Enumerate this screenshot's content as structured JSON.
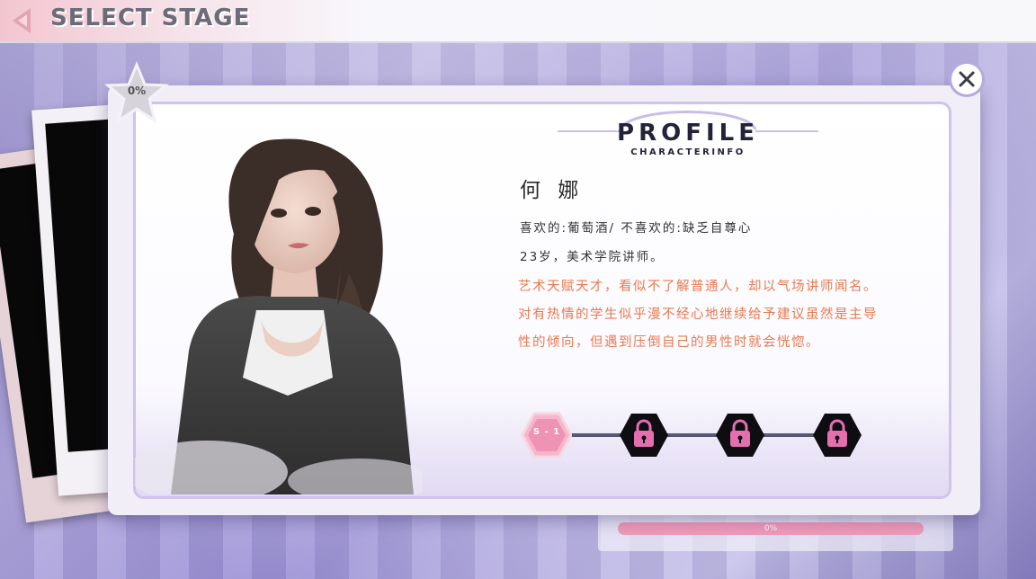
{
  "header": {
    "title": "SELECT STAGE"
  },
  "completion": {
    "percent_label": "0%"
  },
  "background_panel": {
    "progress_label": "0%"
  },
  "profile": {
    "title": "PROFILE",
    "subtitle": "CHARACTERINFO",
    "name": "何 娜",
    "likes_line": "喜欢的:葡萄酒/ 不喜欢的:缺乏自尊心",
    "age_line": "23岁，美术学院讲师。",
    "description": "艺术天赋天才，看似不了解普通人，却以气场讲师闻名。对有热情的学生似乎漫不经心地继续给予建议虽然是主导性的倾向，但遇到压倒自己的男性时就会恍惚。"
  },
  "stages": [
    {
      "label": "S - 1",
      "state": "unlocked"
    },
    {
      "label": "",
      "state": "locked"
    },
    {
      "label": "",
      "state": "locked"
    },
    {
      "label": "",
      "state": "locked"
    }
  ],
  "colors": {
    "accent_pink": "#f09ab8",
    "description_orange": "#e87a4f",
    "frame_purple": "#cfc3ea",
    "lock_pink": "#e36fae"
  }
}
